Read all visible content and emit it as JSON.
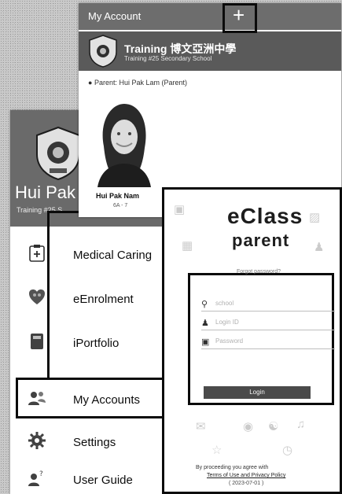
{
  "drawer": {
    "user_name": "Hui Pak",
    "school_sub": "Training #25 S",
    "items": [
      {
        "label": "Medical Caring",
        "icon": "medical-caring-icon"
      },
      {
        "label": "eEnrolment",
        "icon": "eenrolment-icon"
      },
      {
        "label": "iPortfolio",
        "icon": "iportfolio-icon"
      },
      {
        "label": "My Accounts",
        "icon": "my-accounts-icon"
      },
      {
        "label": "Settings",
        "icon": "settings-gear-icon"
      },
      {
        "label": "User Guide",
        "icon": "user-guide-icon"
      }
    ]
  },
  "account": {
    "title": "My Account",
    "add_symbol": "+",
    "school_name": "Training 博文亞洲中學",
    "school_sub": "Training #25 Secondary School",
    "parent_line": "Parent: Hui Pak Lam (Parent)",
    "child_name": "Hui Pak Nam",
    "child_class": "6A - 7"
  },
  "login": {
    "logo_line1": "eClass",
    "logo_line2": "parent",
    "school_placeholder": "school",
    "login_id_placeholder": "Login ID",
    "password_placeholder": "Password",
    "forgot_password": "Forgot password?",
    "login_button": "Login",
    "terms_line1": "By proceeding you agree with",
    "terms_line2": "Terms of Use and Privacy Policy",
    "terms_line3": "( 2023-07-01 )"
  },
  "colors": {
    "header_dark": "#6b6b6b",
    "highlight_border": "#111111",
    "login_button_bg": "#4d4d4d"
  }
}
